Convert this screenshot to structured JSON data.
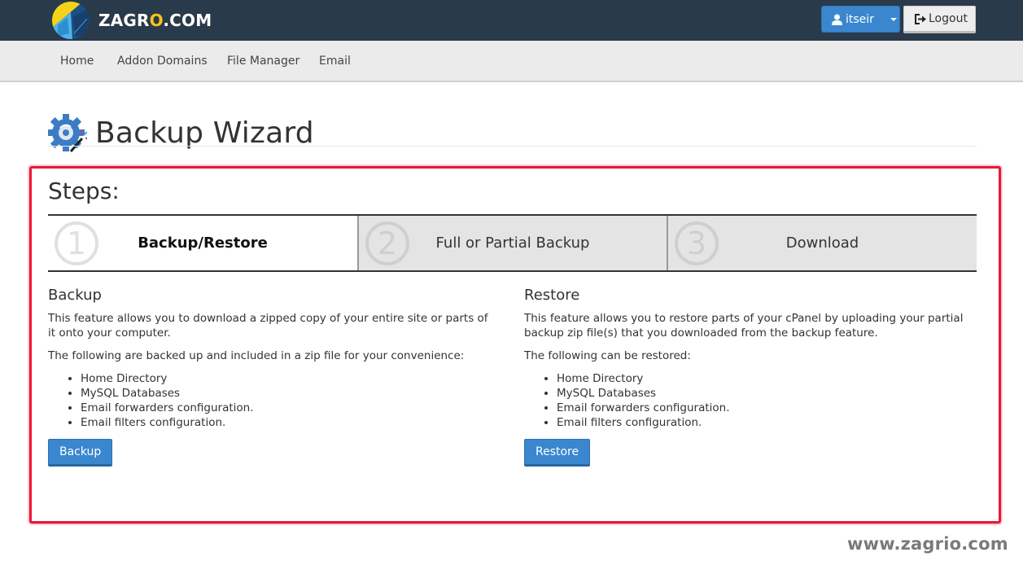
{
  "header": {
    "brand_prefix": "ZAGR",
    "brand_o": "O",
    "brand_suffix": ".COM",
    "user_label": "itseir",
    "logout_label": "Logout"
  },
  "nav": {
    "items": [
      {
        "label": "Home"
      },
      {
        "label": "Addon Domains"
      },
      {
        "label": "File Manager"
      },
      {
        "label": "Email"
      }
    ]
  },
  "page": {
    "title": "Backup Wizard"
  },
  "steps": {
    "title": "Steps:",
    "items": [
      {
        "number": "1",
        "label": "Backup/Restore",
        "active": true
      },
      {
        "number": "2",
        "label": "Full or Partial Backup",
        "active": false
      },
      {
        "number": "3",
        "label": "Download",
        "active": false
      }
    ]
  },
  "backup": {
    "heading": "Backup",
    "description": "This feature allows you to download a zipped copy of your entire site or parts of it onto your computer.",
    "list_intro": "The following are backed up and included in a zip file for your convenience:",
    "items": [
      "Home Directory",
      "MySQL Databases",
      "Email forwarders configuration.",
      "Email filters configuration."
    ],
    "button_label": "Backup"
  },
  "restore": {
    "heading": "Restore",
    "description": "This feature allows you to restore parts of your cPanel by uploading your partial backup zip file(s) that you downloaded from the backup feature.",
    "list_intro": "The following can be restored:",
    "items": [
      "Home Directory",
      "MySQL Databases",
      "Email forwarders configuration.",
      "Email filters configuration."
    ],
    "button_label": "Restore"
  },
  "watermark": "www.zagrio.com",
  "colors": {
    "topbar": "#293a4a",
    "primary": "#3a87cf",
    "highlight": "#e8193a",
    "brand_accent": "#f5c518"
  }
}
